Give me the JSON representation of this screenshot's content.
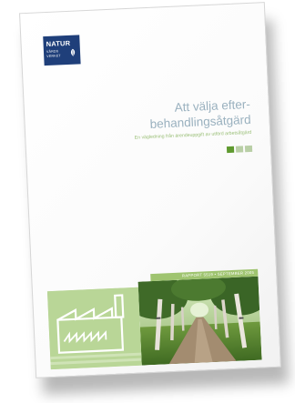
{
  "logo": {
    "main": "NATUR",
    "line1": "VÅRDS",
    "line2": "VERKET",
    "icon": "leaf-icon"
  },
  "title": {
    "line1": "Att välja efter-",
    "line2": "behandlingsåtgärd"
  },
  "subtitle": "En vägledning från ärendeuppgift av utförd arbetsåtgärd",
  "band_text": "RAPPORT 5519 • SEPTEMBER 2005",
  "colors": {
    "logo_bg": "#1f3f7a",
    "title": "#9ab1bf",
    "accent_green": "#9fc470",
    "light_green": "#b9d697"
  },
  "indicator_squares": [
    {
      "name": "square-1",
      "color": "#5f9a2f"
    },
    {
      "name": "square-2",
      "color": "#b9cfa6"
    },
    {
      "name": "square-3",
      "color": "#b9cfa6"
    }
  ]
}
